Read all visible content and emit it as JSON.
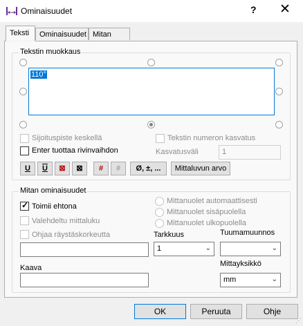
{
  "window": {
    "title": "Ominaisuudet",
    "help": "?",
    "close": "✕"
  },
  "tabs": [
    "Teksti",
    "Ominaisuudet",
    "Mitan päät"
  ],
  "text_edit": {
    "group_title": "Tekstin muokkaus",
    "content": "110°",
    "center_insert_label": "Sijoituspiste keskellä",
    "enter_newline_label": "Enter tuottaa rivinvaihdon",
    "number_increment_label": "Tekstin numeron kasvatus",
    "increment_step_label": "Kasvatusväli",
    "increment_step_value": "1",
    "format_buttons": [
      "U",
      "U",
      "⊠",
      "⊠",
      "#",
      "#",
      "Ø, ±, ..."
    ],
    "measure_value_button": "Mittaluvun arvo"
  },
  "dim_props": {
    "group_title": "Mitan ominaisuudet",
    "works_conditional_label": "Toimii ehtona",
    "fake_dimension_label": "Valehdeltu mittaluku",
    "eaves_height_label": "Ohjaa räystäskorkeutta",
    "arrows_auto_label": "Mittanuolet automaattisesti",
    "arrows_inside_label": "Mittanuolet sisäpuolella",
    "arrows_outside_label": "Mittanuolet ulkopuolella",
    "precision_label": "Tarkkuus",
    "precision_value": "1",
    "inch_conversion_label": "Tuumamuunnos",
    "inch_conversion_value": "",
    "formula_label": "Kaava",
    "unit_label": "Mittayksikkö",
    "unit_value": "mm",
    "field_value": "",
    "formula_value": ""
  },
  "footer": {
    "ok": "OK",
    "cancel": "Peruuta",
    "help": "Ohje"
  }
}
